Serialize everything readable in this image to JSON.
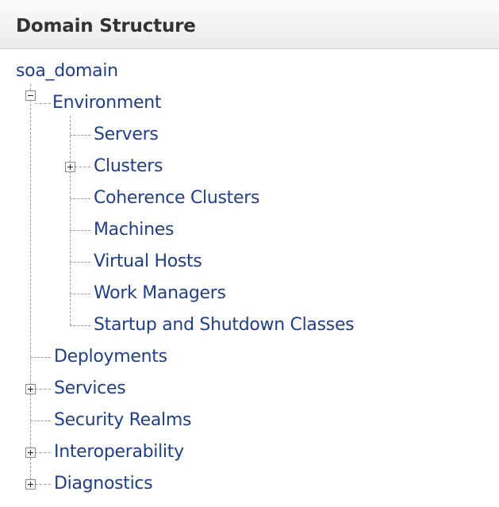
{
  "panel": {
    "title": "Domain Structure"
  },
  "tree": {
    "root": "soa_domain",
    "environment": {
      "label": "Environment",
      "state": "expanded",
      "children": {
        "servers": "Servers",
        "clusters": "Clusters",
        "coherence_clusters": "Coherence Clusters",
        "machines": "Machines",
        "virtual_hosts": "Virtual Hosts",
        "work_managers": "Work Managers",
        "startup_shutdown": "Startup and Shutdown Classes"
      },
      "clusters_state": "collapsed"
    },
    "deployments": "Deployments",
    "services": {
      "label": "Services",
      "state": "collapsed"
    },
    "security_realms": "Security Realms",
    "interoperability": {
      "label": "Interoperability",
      "state": "collapsed"
    },
    "diagnostics": {
      "label": "Diagnostics",
      "state": "collapsed"
    }
  },
  "colors": {
    "link": "#1f3f86",
    "header_text": "#333333",
    "header_bg_top": "#fbfbfb",
    "header_bg_bottom": "#ebebeb",
    "connector": "#9a9a9a"
  }
}
